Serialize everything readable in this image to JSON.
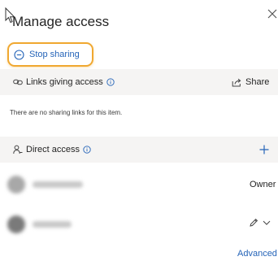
{
  "dialog": {
    "title": "Manage access",
    "stop_sharing_label": "Stop sharing",
    "highlight_color": "#f0a830",
    "link_color": "#2564b8"
  },
  "links_section": {
    "title": "Links giving access",
    "share_label": "Share",
    "empty_message": "There are no sharing links for this item."
  },
  "direct_access": {
    "title": "Direct access",
    "people": [
      {
        "role": "Owner"
      },
      {
        "role": ""
      }
    ]
  },
  "footer": {
    "advanced_label": "Advanced"
  }
}
